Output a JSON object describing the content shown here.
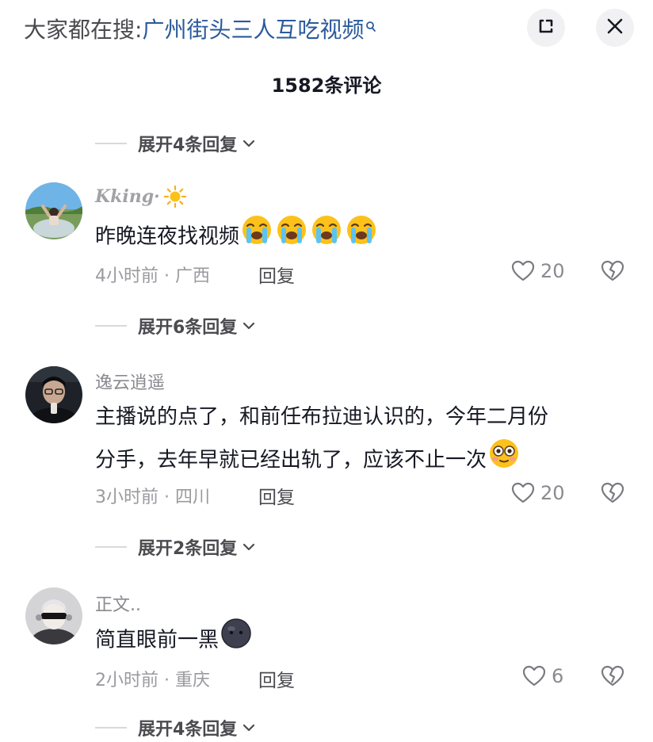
{
  "header": {
    "search_prefix": "大家都在搜:",
    "search_query": "广州街头三人互吃视频"
  },
  "comments_count": "1582条评论",
  "reply_expanders": [
    "展开4条回复",
    "展开6条回复",
    "展开2条回复",
    "展开4条回复"
  ],
  "comments": [
    {
      "username": "Kking·",
      "text_lines": [
        "昨晚连夜找视频"
      ],
      "time_location": "4小时前 · 广西",
      "reply_label": "回复",
      "likes": "20"
    },
    {
      "username": "逸云逍遥",
      "text_lines": [
        "主播说的点了，和前任布拉迪认识的，今年二月份",
        "分手，去年早就已经出轨了，应该不止一次"
      ],
      "time_location": "3小时前 · 四川",
      "reply_label": "回复",
      "likes": "20"
    },
    {
      "username": "正文..",
      "text_lines": [
        "简直眼前一黑"
      ],
      "time_location": "2小时前 · 重庆",
      "reply_label": "回复",
      "likes": "6"
    }
  ],
  "icons": {
    "search_hint": "search-icon",
    "fullscreen": "expand-icon",
    "close": "close-icon",
    "expand_chevron": "chevron-down-icon",
    "like": "heart-icon",
    "dislike": "broken-heart-icon"
  },
  "colors": {
    "query_link": "#2b5a9b",
    "text": "#161823",
    "meta": "#9a9a9f"
  }
}
